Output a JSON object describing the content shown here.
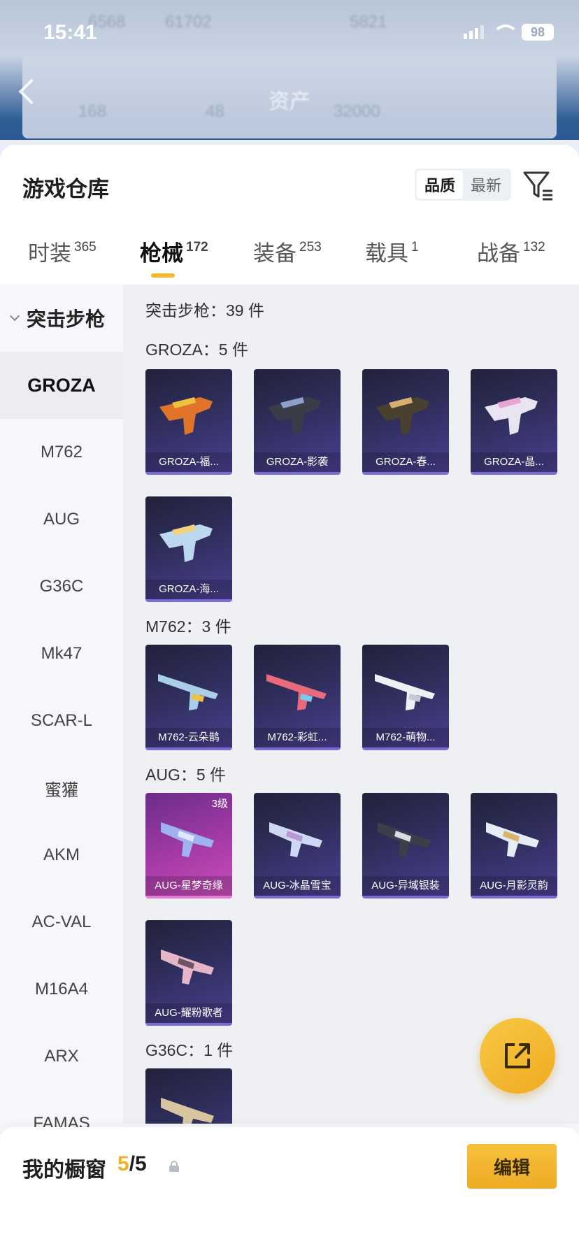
{
  "status_bar": {
    "time": "15:41",
    "battery": "98"
  },
  "background_header": {
    "title": "资产",
    "blurred_numbers": [
      "6568",
      "61702",
      "5821",
      "168",
      "48",
      "32000"
    ]
  },
  "sheet": {
    "title": "游戏仓库",
    "sort": {
      "options": [
        "品质",
        "最新"
      ],
      "selected": "品质"
    },
    "tabs": [
      {
        "label": "时装",
        "count": "365"
      },
      {
        "label": "枪械",
        "count": "172",
        "active": true
      },
      {
        "label": "装备",
        "count": "253"
      },
      {
        "label": "载具",
        "count": "1"
      },
      {
        "label": "战备",
        "count": "132"
      }
    ]
  },
  "sidebar": {
    "group": "突击步枪",
    "items": [
      "GROZA",
      "M762",
      "AUG",
      "G36C",
      "Mk47",
      "SCAR-L",
      "蜜獾",
      "AKM",
      "AC-VAL",
      "M16A4",
      "ARX",
      "FAMAS"
    ],
    "active": "GROZA"
  },
  "content": {
    "total": "突击步枪：39 件",
    "sections": [
      {
        "header": "GROZA：5 件",
        "items": [
          "GROZA-福...",
          "GROZA-影袭",
          "GROZA-春...",
          "GROZA-晶...",
          "GROZA-海..."
        ]
      },
      {
        "header": "M762：3 件",
        "items": [
          "M762-云朵鹊",
          "M762-彩虹...",
          "M762-萌物..."
        ]
      },
      {
        "header": "AUG：5 件",
        "items": [
          "AUG-星梦奇缘",
          "AUG-冰晶雪宝",
          "AUG-异域银装",
          "AUG-月影灵韵",
          "AUG-耀粉歌者"
        ],
        "first_level": "3级"
      },
      {
        "header": "G36C：1 件",
        "items": [
          ""
        ]
      }
    ]
  },
  "bottom_bar": {
    "label": "我的橱窗",
    "count_current": "5",
    "count_total": "/5",
    "edit": "编辑"
  },
  "colors": {
    "accent": "#f5b82a",
    "card_bg": "#2f2e5c",
    "card_pink": "#a53aa6"
  }
}
